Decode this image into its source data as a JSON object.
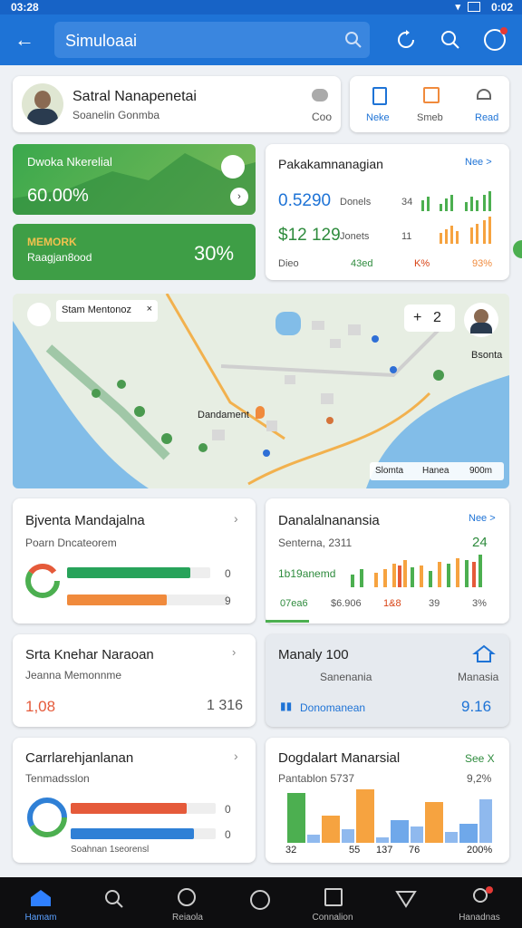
{
  "status": {
    "time": "03:28",
    "right": "0:02"
  },
  "appbar": {
    "title": "Simuloaai"
  },
  "profile": {
    "name": "Satral Nanapenetai",
    "subtitle": "Soanelin Gonmba",
    "action": "Coo"
  },
  "quick_actions": [
    {
      "label": "Neke"
    },
    {
      "label": "Smeb"
    },
    {
      "label": "Read"
    }
  ],
  "green_cards": [
    {
      "title": "Dwoka Nkerelial",
      "value": "60.00%"
    },
    {
      "title": "MEMORK",
      "subtitle": "Raagjan8ood",
      "value": "30%"
    }
  ],
  "stats_card": {
    "title": "Pakakamnanagian",
    "link": "Nee >",
    "rows": [
      {
        "value": "0.5290",
        "label": "Donels",
        "num": "34"
      },
      {
        "value": "$12 129",
        "label": "Jonets",
        "num": "11"
      }
    ],
    "footer": [
      "Dieo",
      "43ed",
      "K%",
      "93%"
    ]
  },
  "map": {
    "search": "Stam Mentonoz",
    "counter": "2",
    "place": "Dandament",
    "region": "Bsonta",
    "scale_labels": [
      "Slomta",
      "Hanea",
      "900m"
    ]
  },
  "card_a": {
    "title": "Bjventa Mandajalna",
    "subtitle": "Poarn Dncateorem",
    "vals": [
      "0",
      "9"
    ],
    "progress": [
      0.86,
      0.62
    ]
  },
  "card_b": {
    "title": "Danalalnanansia",
    "link": "Nee >",
    "subtitle": "Senterna, 2311",
    "big": "24",
    "chart_label": "1b19anemd",
    "footer": [
      "07ea6",
      "$6.906",
      "1&8",
      "39",
      "3%"
    ]
  },
  "card_c": {
    "title": "Srta Knehar Naraoan",
    "subtitle": "Jeanna Memonnme",
    "left": "1,08",
    "right": "1 316"
  },
  "card_d": {
    "title": "Manaly 100",
    "subtitle": "Sanenania",
    "right_label": "Manasia",
    "footer_label": "Donomanean",
    "value": "9.16"
  },
  "card_e": {
    "title": "Carrlarehjanlanan",
    "subtitle": "Tenmadsslon",
    "link_label": "Soahnan 1seorensl",
    "vals": [
      "0",
      "0"
    ],
    "progress": [
      0.8,
      0.85
    ]
  },
  "card_f": {
    "title": "Dogdalart Manarsial",
    "link": "See X",
    "subtitle": "Pantablon 5737",
    "percent": "9,2%",
    "bar_labels": [
      "32",
      "55",
      "137",
      "76",
      "200%"
    ],
    "bars": [
      {
        "color": "#4caf50",
        "values": [
          0.92,
          0.15
        ]
      },
      {
        "color": "#f6a340",
        "values": [
          0.5,
          0.25
        ]
      },
      {
        "color": "#f6a340",
        "values": [
          0.98,
          0.1
        ]
      },
      {
        "color": "#6fa8ea",
        "values": [
          0.42,
          0.3
        ]
      },
      {
        "color": "#f6a340",
        "values": [
          0.75,
          0.2
        ]
      },
      {
        "color": "#6fa8ea",
        "values": [
          0.35,
          0.8
        ]
      }
    ]
  },
  "bottom_nav": [
    {
      "label": "Hamam"
    },
    {
      "label": ""
    },
    {
      "label": "Reiaola"
    },
    {
      "label": ""
    },
    {
      "label": "Connalion"
    },
    {
      "label": ""
    },
    {
      "label": "Hanadnas"
    }
  ],
  "colors": {
    "primary": "#1e73d6",
    "green": "#4caf50",
    "orange": "#f08a3c"
  }
}
